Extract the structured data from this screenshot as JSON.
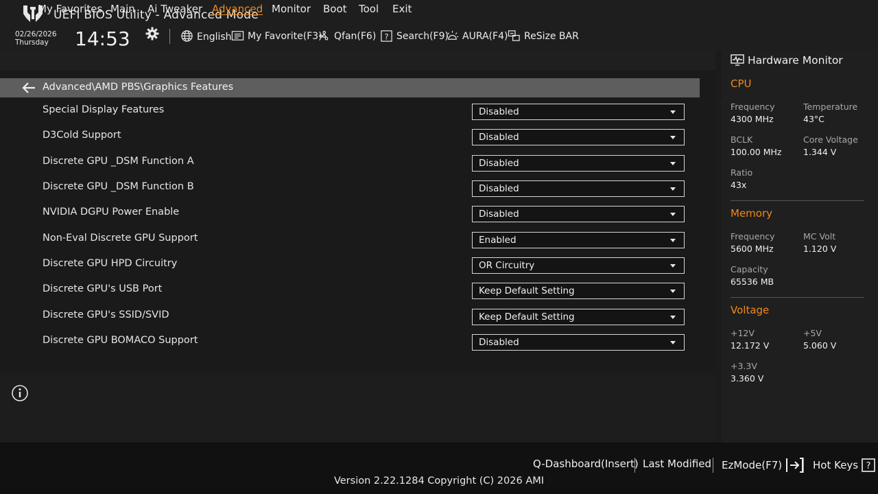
{
  "header": {
    "title": "UEFI BIOS Utility - Advanced Mode",
    "date": "02/26/2026",
    "day": "Thursday",
    "time": "14:53"
  },
  "toolbar": {
    "language": "English",
    "my_favorite": "My Favorite(F3)",
    "qfan": "Qfan(F6)",
    "search": "Search(F9)",
    "aura": "AURA(F4)",
    "resize_bar": "ReSize BAR"
  },
  "menu": {
    "tabs": [
      "My Favorites",
      "Main",
      "Ai Tweaker",
      "Advanced",
      "Monitor",
      "Boot",
      "Tool",
      "Exit"
    ],
    "active": "Advanced"
  },
  "breadcrumb": "Advanced\\AMD PBS\\Graphics Features",
  "settings": [
    {
      "label": "Special Display Features",
      "value": "Disabled"
    },
    {
      "label": "D3Cold Support",
      "value": "Disabled"
    },
    {
      "label": "Discrete GPU _DSM Function A",
      "value": "Disabled"
    },
    {
      "label": "Discrete GPU _DSM Function B",
      "value": "Disabled"
    },
    {
      "label": "NVIDIA DGPU Power Enable",
      "value": "Disabled"
    },
    {
      "label": "Non-Eval Discrete GPU Support",
      "value": "Enabled"
    },
    {
      "label": "Discrete GPU HPD Circuitry",
      "value": "OR Circuitry"
    },
    {
      "label": "Discrete GPU's USB Port",
      "value": "Keep Default Setting"
    },
    {
      "label": "Discrete GPU's SSID/SVID",
      "value": "Keep Default Setting"
    },
    {
      "label": "Discrete GPU BOMACO Support",
      "value": "Disabled"
    }
  ],
  "hardware_monitor": {
    "title": "Hardware Monitor",
    "cpu": {
      "heading": "CPU",
      "frequency_label": "Frequency",
      "frequency": "4300 MHz",
      "temperature_label": "Temperature",
      "temperature": "43°C",
      "bclk_label": "BCLK",
      "bclk": "100.00 MHz",
      "core_voltage_label": "Core Voltage",
      "core_voltage": "1.344 V",
      "ratio_label": "Ratio",
      "ratio": "43x"
    },
    "memory": {
      "heading": "Memory",
      "frequency_label": "Frequency",
      "frequency": "5600 MHz",
      "mc_volt_label": "MC Volt",
      "mc_volt": "1.120 V",
      "capacity_label": "Capacity",
      "capacity": "65536 MB"
    },
    "voltage": {
      "heading": "Voltage",
      "v12_label": "+12V",
      "v12": "12.172 V",
      "v5_label": "+5V",
      "v5": "5.060 V",
      "v33_label": "+3.3V",
      "v33": "3.360 V"
    }
  },
  "footer": {
    "q_dashboard": "Q-Dashboard(Insert)",
    "last_modified": "Last Modified",
    "ezmode": "EzMode(F7)",
    "hot_keys": "Hot Keys",
    "version": "Version 2.22.1284 Copyright (C) 2026 AMI"
  },
  "colors": {
    "accent": "#f08a1a",
    "background": "#1b1b1b",
    "breadcrumb_bar": "#5e5e5e"
  }
}
